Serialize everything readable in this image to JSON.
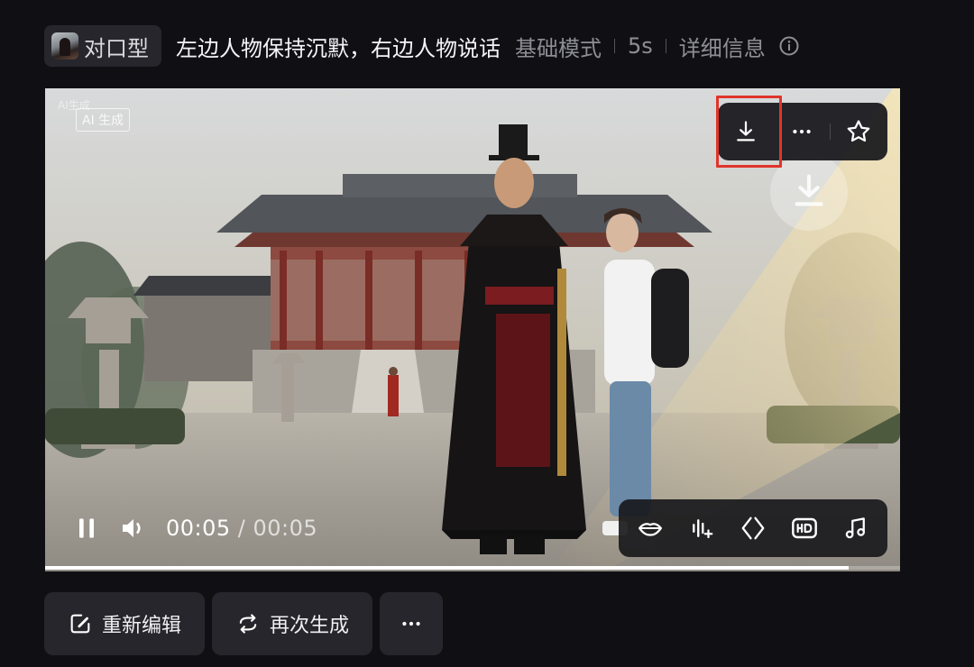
{
  "header": {
    "type_label": "对口型",
    "prompt": "左边人物保持沉默，右边人物说话",
    "mode": "基础模式",
    "duration": "5s",
    "details": "详细信息"
  },
  "video": {
    "watermark_small": "AI生成",
    "watermark_main": "AI 生成",
    "current_time": "00:05",
    "time_separator": " / ",
    "total_time": "00:05",
    "progress": 0.94,
    "playing": true,
    "top_tools": [
      "download-icon",
      "more-icon",
      "star-icon"
    ],
    "bottom_tools": [
      "lip-sync-icon",
      "audio-wave-icon",
      "frame-icon",
      "hd-icon",
      "music-note-icon"
    ],
    "highlight_color": "#e0352b"
  },
  "actions": {
    "edit_label": "重新编辑",
    "regenerate_label": "再次生成"
  }
}
